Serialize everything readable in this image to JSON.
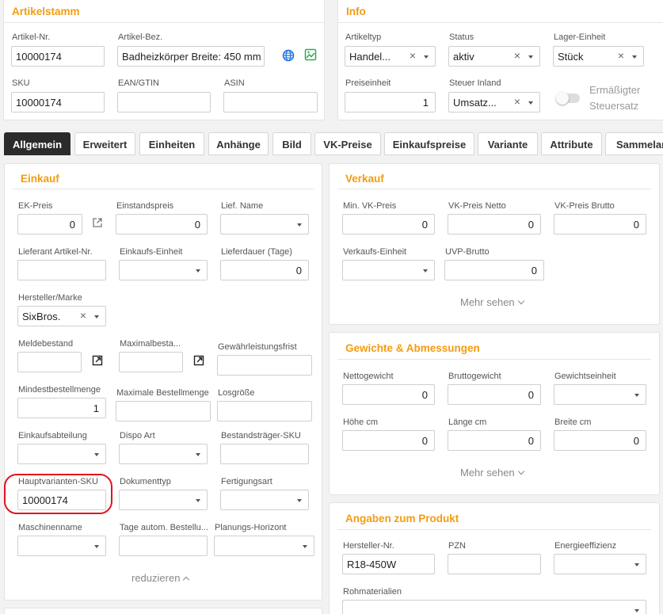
{
  "artikelstamm": {
    "title": "Artikelstamm",
    "artikel_nr": {
      "label": "Artikel-Nr.",
      "value": "10000174"
    },
    "artikel_bez": {
      "label": "Artikel-Bez.",
      "value": "Badheizkörper Breite: 450 mm"
    },
    "sku": {
      "label": "SKU",
      "value": "10000174"
    },
    "ean": {
      "label": "EAN/GTIN",
      "value": ""
    },
    "asin": {
      "label": "ASIN",
      "value": ""
    },
    "icons": [
      "globe-icon",
      "image-icon"
    ]
  },
  "info": {
    "title": "Info",
    "artikeltyp": {
      "label": "Artikeltyp",
      "value": "Handel..."
    },
    "status": {
      "label": "Status",
      "value": "aktiv"
    },
    "lager_einheit": {
      "label": "Lager-Einheit",
      "value": "Stück"
    },
    "preiseinheit": {
      "label": "Preiseinheit",
      "value": "1"
    },
    "steuer_inland": {
      "label": "Steuer Inland",
      "value": "Umsatz..."
    },
    "ermaessigter": {
      "label_line1": "Ermäßigter",
      "label_line2": "Steuersatz",
      "enabled": false
    }
  },
  "tabs": [
    "Allgemein",
    "Erweitert",
    "Einheiten",
    "Anhänge",
    "Bild",
    "VK-Preise",
    "Einkaufspreise",
    "Variante",
    "Attribute",
    "Sammelar"
  ],
  "active_tab": "Allgemein",
  "einkauf": {
    "title": "Einkauf",
    "ek_preis": {
      "label": "EK-Preis",
      "value": "0"
    },
    "einstandspreis": {
      "label": "Einstandspreis",
      "value": "0"
    },
    "lief_name": {
      "label": "Lief. Name",
      "value": ""
    },
    "lieferant_artikel_nr": {
      "label": "Lieferant Artikel-Nr.",
      "value": ""
    },
    "einkaufs_einheit": {
      "label": "Einkaufs-Einheit",
      "value": ""
    },
    "lieferdauer": {
      "label": "Lieferdauer (Tage)",
      "value": "0"
    },
    "hersteller_marke": {
      "label": "Hersteller/Marke",
      "value": "SixBros."
    },
    "meldebestand": {
      "label": "Meldebestand",
      "value": ""
    },
    "maximalbestand": {
      "label": "Maximalbesta...",
      "value": ""
    },
    "gewaehrleistungsfrist": {
      "label": "Gewährleistungsfrist",
      "value": ""
    },
    "mindestbestellmenge": {
      "label": "Mindestbestellmenge",
      "value": "1"
    },
    "maximale_bestellmenge": {
      "label": "Maximale Bestellmenge",
      "value": ""
    },
    "losgroesse": {
      "label": "Losgröße",
      "value": ""
    },
    "einkaufsabteilung": {
      "label": "Einkaufsabteilung",
      "value": ""
    },
    "dispo_art": {
      "label": "Dispo Art",
      "value": ""
    },
    "bestandstraeger_sku": {
      "label": "Bestandsträger-SKU",
      "value": ""
    },
    "hauptvarianten_sku": {
      "label": "Hauptvarianten-SKU",
      "value": "10000174"
    },
    "dokumenttyp": {
      "label": "Dokumenttyp",
      "value": ""
    },
    "fertigungsart": {
      "label": "Fertigungsart",
      "value": ""
    },
    "maschinenname": {
      "label": "Maschinenname",
      "value": ""
    },
    "tage_autom": {
      "label": "Tage autom. Bestellu...",
      "value": ""
    },
    "planungs_horizont": {
      "label": "Planungs-Horizont",
      "value": ""
    },
    "collapse_label": "reduzieren"
  },
  "verkauf": {
    "title": "Verkauf",
    "min_vk": {
      "label": "Min. VK-Preis",
      "value": "0"
    },
    "vk_netto": {
      "label": "VK-Preis Netto",
      "value": "0"
    },
    "vk_brutto": {
      "label": "VK-Preis Brutto",
      "value": "0"
    },
    "verkaufs_einheit": {
      "label": "Verkaufs-Einheit",
      "value": ""
    },
    "uvp_brutto": {
      "label": "UVP-Brutto",
      "value": "0"
    },
    "more_label": "Mehr sehen"
  },
  "gewichte": {
    "title": "Gewichte & Abmessungen",
    "nettogewicht": {
      "label": "Nettogewicht",
      "value": "0"
    },
    "bruttogewicht": {
      "label": "Bruttogewicht",
      "value": "0"
    },
    "gewichtseinheit": {
      "label": "Gewichtseinheit",
      "value": ""
    },
    "hoehe": {
      "label": "Höhe cm",
      "value": "0"
    },
    "laenge": {
      "label": "Länge cm",
      "value": "0"
    },
    "breite": {
      "label": "Breite cm",
      "value": "0"
    },
    "more_label": "Mehr sehen"
  },
  "produkt": {
    "title": "Angaben zum Produkt",
    "hersteller_nr": {
      "label": "Hersteller-Nr.",
      "value": "R18-450W"
    },
    "pzn": {
      "label": "PZN",
      "value": ""
    },
    "energieeffizienz": {
      "label": "Energieeffizienz",
      "value": ""
    },
    "rohmaterialien": {
      "label": "Rohmaterialien",
      "value": ""
    }
  },
  "colors": {
    "accent": "#f39c12",
    "active_tab": "#2b2b2b",
    "highlight": "#e0141e",
    "globe": "#1e6fd9",
    "image": "#2eaa4f"
  }
}
